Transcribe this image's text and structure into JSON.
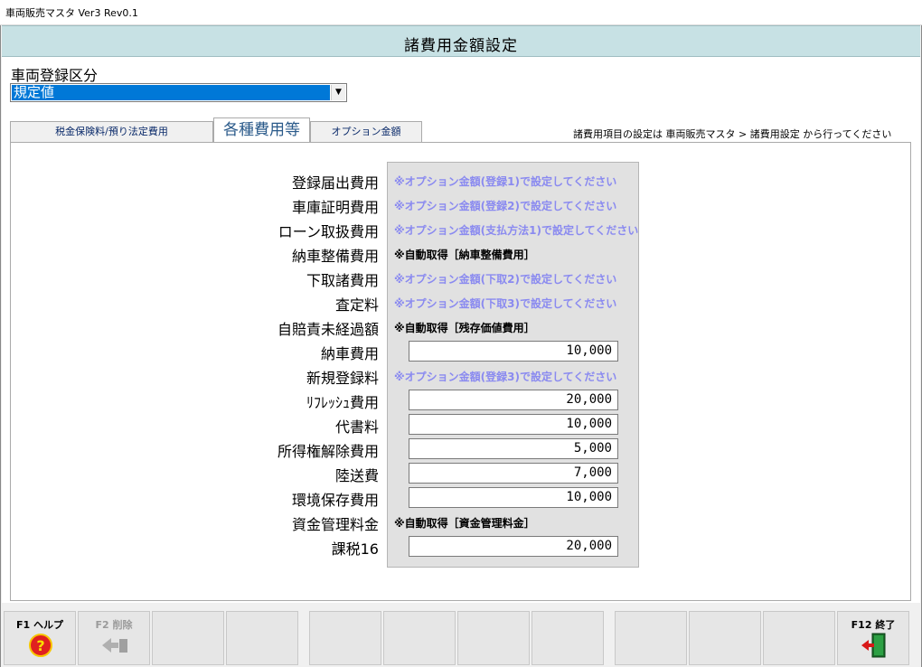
{
  "window": {
    "title": "車両販売マスタ Ver3 Rev0.1"
  },
  "header": {
    "title": "諸費用金額設定"
  },
  "registration": {
    "label": "車両登録区分",
    "selected": "規定値"
  },
  "tabs": [
    {
      "label": "税金保険料/預り法定費用",
      "active": false
    },
    {
      "label": "各種費用等",
      "active": true
    },
    {
      "label": "オプション金額",
      "active": false
    }
  ],
  "tab_note": "諸費用項目の設定は 車両販売マスタ > 諸費用設定 から行ってください",
  "rows": [
    {
      "label": "登録届出費用",
      "kind": "note_blue",
      "text": "※オプション金額(登録1)で設定してください"
    },
    {
      "label": "車庫証明費用",
      "kind": "note_blue",
      "text": "※オプション金額(登録2)で設定してください"
    },
    {
      "label": "ローン取扱費用",
      "kind": "note_blue",
      "text": "※オプション金額(支払方法1)で設定してください"
    },
    {
      "label": "納車整備費用",
      "kind": "note_black",
      "text": "※自動取得［納車整備費用］"
    },
    {
      "label": "下取諸費用",
      "kind": "note_blue",
      "text": "※オプション金額(下取2)で設定してください"
    },
    {
      "label": "査定料",
      "kind": "note_blue",
      "text": "※オプション金額(下取3)で設定してください"
    },
    {
      "label": "自賠責未経過額",
      "kind": "note_black",
      "text": "※自動取得［残存価値費用］"
    },
    {
      "label": "納車費用",
      "kind": "input",
      "value": "10,000"
    },
    {
      "label": "新規登録料",
      "kind": "note_blue",
      "text": "※オプション金額(登録3)で設定してください"
    },
    {
      "label": "ﾘﾌﾚｯｼｭ費用",
      "kind": "input",
      "value": "20,000"
    },
    {
      "label": "代書料",
      "kind": "input",
      "value": "10,000"
    },
    {
      "label": "所得権解除費用",
      "kind": "input",
      "value": "5,000"
    },
    {
      "label": "陸送費",
      "kind": "input",
      "value": "7,000"
    },
    {
      "label": "環境保存費用",
      "kind": "input",
      "value": "10,000"
    },
    {
      "label": "資金管理料金",
      "kind": "note_black",
      "text": "※自動取得［資金管理料金］"
    },
    {
      "label": "課税16",
      "kind": "input",
      "value": "20,000"
    }
  ],
  "function_keys": [
    {
      "label": "F1 ヘルプ",
      "icon": "help-icon",
      "enabled": true
    },
    {
      "label": "F2 削除",
      "icon": "delete-icon",
      "enabled": false
    },
    {
      "label": "",
      "icon": "",
      "enabled": false
    },
    {
      "label": "",
      "icon": "",
      "enabled": false
    },
    {
      "label": "",
      "icon": "",
      "enabled": false
    },
    {
      "label": "",
      "icon": "",
      "enabled": false
    },
    {
      "label": "",
      "icon": "",
      "enabled": false
    },
    {
      "label": "",
      "icon": "",
      "enabled": false
    },
    {
      "label": "",
      "icon": "",
      "enabled": false
    },
    {
      "label": "",
      "icon": "",
      "enabled": false
    },
    {
      "label": "",
      "icon": "",
      "enabled": false
    },
    {
      "label": "F12 終了",
      "icon": "exit-door-icon",
      "enabled": true
    }
  ]
}
